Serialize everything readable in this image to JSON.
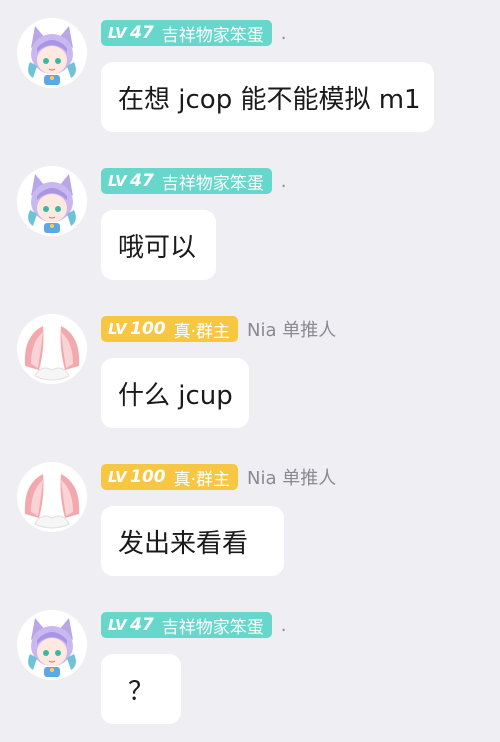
{
  "messages": [
    {
      "level_prefix": "LV",
      "level": "47",
      "title": "吉祥物家笨蛋",
      "nickname": ".",
      "text": "在想 jcop 能不能模拟 m1",
      "avatar": "anime-girl-avatar-icon",
      "badge_color": "#67d7cc"
    },
    {
      "level_prefix": "LV",
      "level": "47",
      "title": "吉祥物家笨蛋",
      "nickname": ".",
      "text": "哦可以",
      "avatar": "anime-girl-avatar-icon",
      "badge_color": "#67d7cc"
    },
    {
      "level_prefix": "LV",
      "level": "100",
      "title": "真·群主",
      "nickname": "Nia 单推人",
      "text": "什么 jcup",
      "avatar": "pink-ears-avatar-icon",
      "badge_color": "#f7c744"
    },
    {
      "level_prefix": "LV",
      "level": "100",
      "title": "真·群主",
      "nickname": "Nia 单推人",
      "text": "发出来看看",
      "avatar": "pink-ears-avatar-icon",
      "badge_color": "#f7c744"
    },
    {
      "level_prefix": "LV",
      "level": "47",
      "title": "吉祥物家笨蛋",
      "nickname": ".",
      "text": "？",
      "avatar": "anime-girl-avatar-icon",
      "badge_color": "#67d7cc"
    }
  ]
}
